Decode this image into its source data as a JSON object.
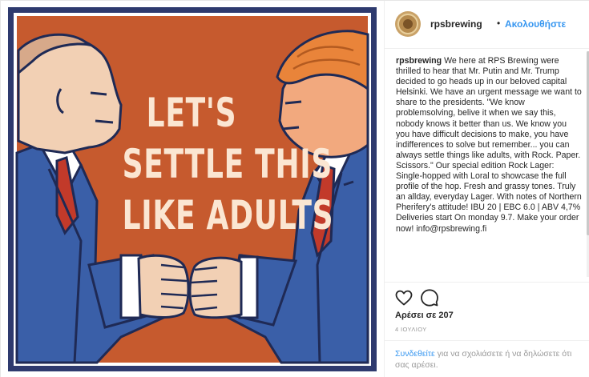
{
  "artwork": {
    "headline_lines": [
      "LET'S",
      "SETTLE THIS",
      "LIKE ADULTS"
    ],
    "colors": {
      "background_orange": "#c65a2e",
      "frame_navy": "#2e3a6e",
      "suit_blue": "#3a5fa8",
      "tie_red": "#c23a2a",
      "skin": "#f2d0b4",
      "hair_orange": "#e9843a",
      "headline": "#fbe6d2"
    }
  },
  "header": {
    "username": "rpsbrewing",
    "separator": "•",
    "follow_label": "Ακολουθήστε",
    "avatar_icon": "brewery-logo-avatar"
  },
  "caption": {
    "username": "rpsbrewing",
    "text": "We here at RPS Brewing were thrilled to hear that Mr. Putin and Mr. Trump decided to go heads up in our beloved capital Helsinki. We have an urgent message we want to share to the presidents. \"We know problemsolving, belive it when we say this, nobody knows it better than us. We know you you have difficult decisions to make, you have indifferences to solve but remember... you can always settle things like adults, with Rock. Paper. Scissors.\" Our special edition Rock Lager: Single-hopped with Loral to showcase the full profile of the hop. Fresh and grassy tones. Truly an allday, everyday Lager. With notes of Northern Pherifery's attitude! IBU 20 | EBC 6.0 | ABV 4,7% Deliveries start On monday 9.7. Make your order now! info@rpsbrewing.fi"
  },
  "actions": {
    "like_icon": "heart-icon",
    "comment_icon": "comment-bubble-icon",
    "likes_text": "Αρέσει σε 207",
    "date_text": "4 ΙΟΥΛΙΟΥ"
  },
  "login": {
    "link_label": "Συνδεθείτε",
    "rest_text": " για να σχολιάσετε ή να δηλώσετε ότι σας αρέσει."
  }
}
